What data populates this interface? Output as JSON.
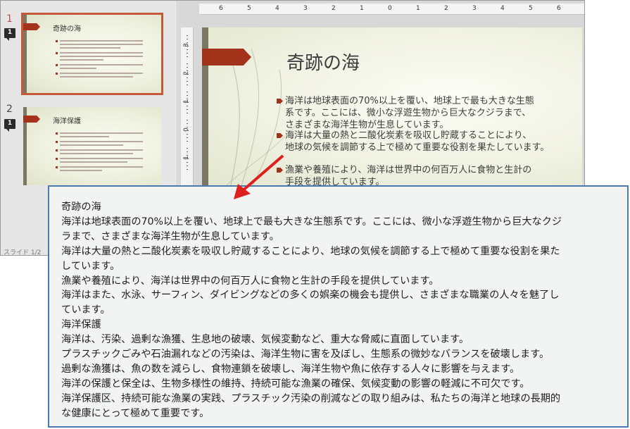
{
  "thumbnails": [
    {
      "number": "1",
      "comment_count": "1",
      "title": "奇跡の海",
      "selected": true,
      "body_lines": 11
    },
    {
      "number": "2",
      "comment_count": "1",
      "title": "海洋保護",
      "selected": false,
      "body_lines": 11
    }
  ],
  "status_text": "スライド 1/2",
  "ruler": {
    "horizontal_labels": [
      "6",
      "5",
      "4",
      "3",
      "2",
      "1",
      "0",
      "1",
      "2",
      "3",
      "4",
      "5",
      "6"
    ],
    "vertical_labels": [
      "3",
      "2",
      "1",
      "0",
      "1"
    ]
  },
  "slide": {
    "title": "奇跡の海",
    "bullets": [
      [
        "海洋は地球表面の70%以上を覆い、地球上で最も大きな生態",
        "系です。ここには、微小な浮遊生物から巨大なクジラまで、",
        "さまざまな海洋生物が生息しています。"
      ],
      [
        "海洋は大量の熱と二酸化炭素を吸収し貯蔵することにより、",
        "地球の気候を調節する上で極めて重要な役割を果たしています。"
      ],
      [
        "漁業や養殖により、海洋は世界中の何百万人に食物と生計の",
        "手段を提供しています。"
      ]
    ]
  },
  "tooltip": {
    "lines": [
      "奇跡の海",
      "海洋は地球表面の70%以上を覆い、地球上で最も大きな生態系です。ここには、微小な浮遊生物から巨大なクジ",
      "ラまで、さまざまな海洋生物が生息しています。",
      "海洋は大量の熱と二酸化炭素を吸収し貯蔵することにより、地球の気候を調節する上で極めて重要な役割を果た",
      "しています。",
      "漁業や養殖により、海洋は世界中の何百万人に食物と生計の手段を提供しています。",
      "海洋はまた、水泳、サーフィン、ダイビングなどの多くの娯楽の機会も提供し、さまざまな職業の人々を魅了し",
      "ています。",
      "海洋保護",
      "海洋は、汚染、過剰な漁獲、生息地の破壊、気候変動など、重大な脅威に直面しています。",
      "プラスチックごみや石油漏れなどの汚染は、海洋生物に害を及ぼし、生態系の微妙なバランスを破壊します。",
      "過剰な漁獲は、魚の数を減らし、食物連鎖を破壊し、海洋生物や魚に依存する人々に影響を与えます。",
      "海洋の保護と保全は、生物多様性の維持、持続可能な漁業の確保、気候変動の影響の軽減に不可欠です。",
      "海洋保護区、持続可能な漁業の実践、プラスチック汚染の削減などの取り組みは、私たちの海洋と地球の長期的",
      "な健康にとって極めて重要です。"
    ]
  },
  "colors": {
    "accent_red": "#a3321b",
    "selection": "#c55a3a",
    "tooltip_border": "#4a7bb8",
    "pointer_arrow": "#e0201c"
  }
}
